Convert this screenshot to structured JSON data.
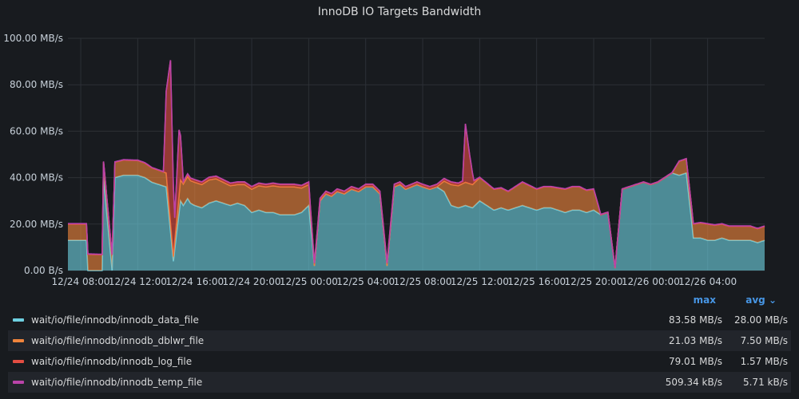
{
  "panel": {
    "title": "InnoDB IO Targets Bandwidth"
  },
  "legend": {
    "header_max": "max",
    "header_avg": "avg ⌄",
    "rows": [
      {
        "name": "wait/io/file/innodb/innodb_data_file",
        "max": "83.58 MB/s",
        "avg": "28.00 MB/s",
        "color": "#6ed0e0"
      },
      {
        "name": "wait/io/file/innodb/innodb_dblwr_file",
        "max": "21.03 MB/s",
        "avg": "7.50 MB/s",
        "color": "#ef843c"
      },
      {
        "name": "wait/io/file/innodb/innodb_log_file",
        "max": "79.01 MB/s",
        "avg": "1.57 MB/s",
        "color": "#e24d42"
      },
      {
        "name": "wait/io/file/innodb/innodb_temp_file",
        "max": "509.34 kB/s",
        "avg": "5.71 kB/s",
        "color": "#ba43a9"
      }
    ]
  },
  "chart_data": {
    "type": "area",
    "stacked": true,
    "title": "InnoDB IO Targets Bandwidth",
    "unit": "MB/s",
    "ylim": [
      0,
      100
    ],
    "y_ticks": [
      "0.00 B/s",
      "20.00 MB/s",
      "40.00 MB/s",
      "60.00 MB/s",
      "80.00 MB/s",
      "100.00 MB/s"
    ],
    "y_tick_values": [
      0,
      20,
      40,
      60,
      80,
      100
    ],
    "x_ticks": [
      "12/24 08:00",
      "12/24 12:00",
      "12/24 16:00",
      "12/24 20:00",
      "12/25 00:00",
      "12/25 04:00",
      "12/25 08:00",
      "12/25 12:00",
      "12/25 16:00",
      "12/25 20:00",
      "12/26 00:00",
      "12/26 04:00"
    ],
    "x_tick_hours": [
      8,
      12,
      16,
      20,
      24,
      28,
      32,
      36,
      40,
      44,
      48,
      52
    ],
    "xlim_hours": [
      7.1,
      56.0
    ],
    "grid": true,
    "legend_position": "bottom",
    "series": [
      {
        "name": "wait/io/file/innodb/innodb_data_file",
        "color": "#6ed0e0",
        "x": [
          7.1,
          8.4,
          8.5,
          9.5,
          9.6,
          10.2,
          10.4,
          11.0,
          11.2,
          12.0,
          12.5,
          13.0,
          13.5,
          14.0,
          14.5,
          15.0,
          15.2,
          15.5,
          15.7,
          16.0,
          16.5,
          17.0,
          17.5,
          18.0,
          18.5,
          19.0,
          19.5,
          20.0,
          20.5,
          21.0,
          21.5,
          22.0,
          22.5,
          23.0,
          23.5,
          24.0,
          24.4,
          24.8,
          25.2,
          25.6,
          26.0,
          26.5,
          27.0,
          27.5,
          28.0,
          28.5,
          29.0,
          29.5,
          30.0,
          30.4,
          30.8,
          31.2,
          31.6,
          32.0,
          32.5,
          33.0,
          33.5,
          34.0,
          34.5,
          35.0,
          35.5,
          36.0,
          36.5,
          37.0,
          37.5,
          38.0,
          38.5,
          39.0,
          39.5,
          40.0,
          40.5,
          41.0,
          41.5,
          42.0,
          42.5,
          43.0,
          43.5,
          44.0,
          44.5,
          45.0,
          45.5,
          46.0,
          46.5,
          47.0,
          47.5,
          48.0,
          48.5,
          49.0,
          49.5,
          50.0,
          50.5,
          51.0,
          51.5,
          52.0,
          52.5,
          53.0,
          53.5,
          54.0,
          54.5,
          55.0,
          55.5,
          56.0
        ],
        "values": [
          13,
          13,
          0,
          0,
          40,
          0,
          40,
          41,
          41,
          41,
          40,
          38,
          37,
          36,
          4,
          30,
          28,
          31,
          29,
          28,
          27,
          29,
          30,
          29,
          28,
          29,
          28,
          25,
          26,
          25,
          25,
          24,
          24,
          24,
          25,
          28,
          2,
          30,
          33,
          32,
          34,
          33,
          35,
          34,
          36,
          36,
          33,
          2,
          36,
          37,
          35,
          36,
          37,
          36,
          35,
          36,
          34,
          28,
          27,
          28,
          27,
          30,
          28,
          26,
          27,
          26,
          27,
          28,
          27,
          26,
          27,
          27,
          26,
          25,
          26,
          26,
          25,
          26,
          24,
          25,
          1,
          35,
          36,
          37,
          38,
          37,
          38,
          40,
          42,
          41,
          42,
          14,
          14,
          13,
          13,
          14,
          13,
          13,
          13,
          13,
          12,
          13
        ]
      },
      {
        "name": "wait/io/file/innodb/innodb_dblwr_file",
        "color": "#ef843c",
        "x": [
          7.1,
          8.4,
          14.0,
          14.5,
          15.0,
          16.0,
          17.0,
          18.0,
          19.0,
          20.0,
          21.0,
          22.0,
          23.0,
          24.0,
          24.4,
          33.0,
          34.0,
          35.0,
          36.0,
          37.0,
          38.0,
          39.0,
          40.0,
          41.0,
          42.0,
          43.0,
          44.0,
          44.5,
          49.5,
          50.0,
          51.0,
          52.0,
          53.0,
          54.0,
          55.0,
          56.0
        ],
        "values": [
          7,
          7,
          6,
          2,
          9,
          10,
          10,
          9,
          8,
          10,
          11,
          12,
          12,
          9,
          0,
          0,
          9,
          10,
          10,
          9,
          8,
          10,
          9,
          9,
          10,
          10,
          9,
          0,
          0,
          6,
          6,
          7,
          6,
          6,
          6,
          6
        ]
      },
      {
        "name": "wait/io/file/innodb/innodb_log_file",
        "color": "#e24d42",
        "x": [
          7.1,
          13.8,
          14.0,
          14.3,
          14.6,
          14.9,
          15.2,
          16.0,
          24.0,
          34.8,
          35.0,
          35.3,
          35.6,
          36.0,
          56.0
        ],
        "values": [
          0,
          0,
          35,
          70,
          10,
          28,
          1,
          1,
          1,
          1,
          25,
          12,
          1,
          0,
          0
        ]
      },
      {
        "name": "wait/io/file/innodb/innodb_temp_file",
        "color": "#ba43a9",
        "x": [
          7.1,
          56.0
        ],
        "values": [
          0.2,
          0.2
        ]
      }
    ]
  }
}
